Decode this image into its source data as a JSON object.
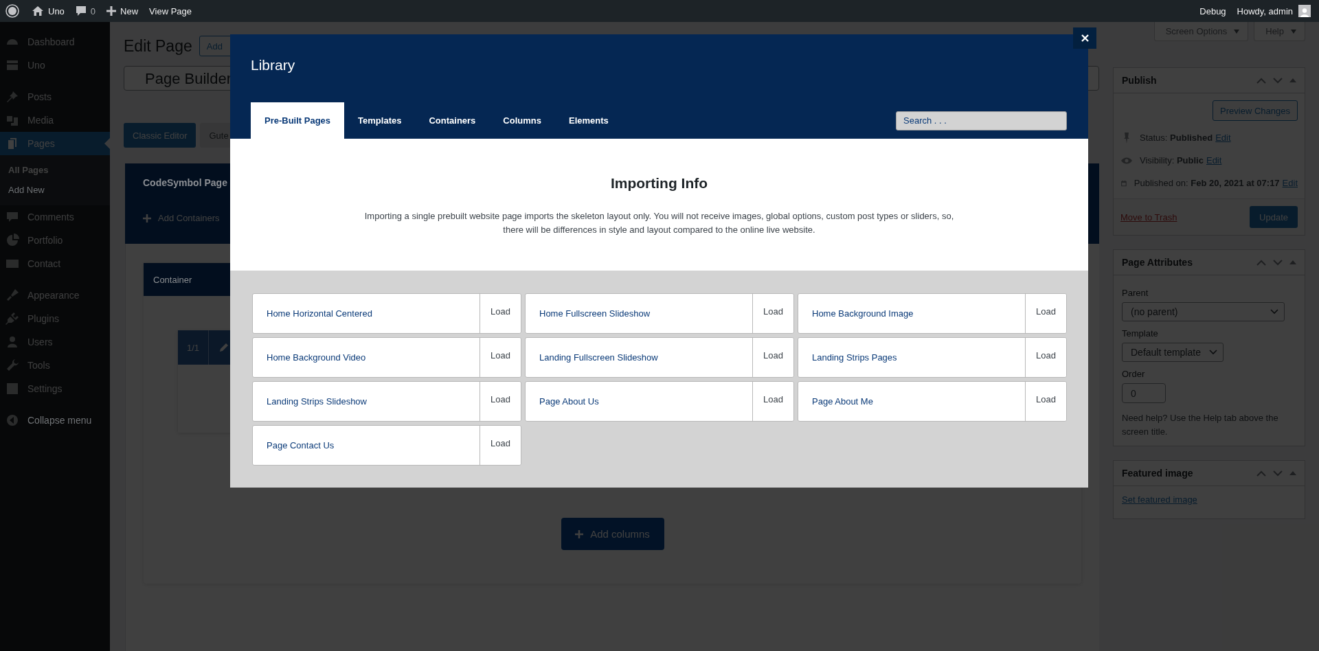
{
  "admin_bar": {
    "site": "Uno",
    "comments": "0",
    "new": "New",
    "view": "View Page",
    "debug": "Debug",
    "howdy": "Howdy, admin"
  },
  "sidebar": {
    "groups": [
      [
        {
          "label": "Dashboard",
          "selected": false
        },
        {
          "label": "Uno",
          "selected": false
        }
      ],
      [
        {
          "label": "Posts",
          "selected": false
        },
        {
          "label": "Media",
          "selected": false
        },
        {
          "label": "Pages",
          "selected": true,
          "children": [
            {
              "label": "All Pages",
              "selected": true
            },
            {
              "label": "Add New",
              "selected": false
            }
          ]
        },
        {
          "label": "Comments",
          "selected": false
        },
        {
          "label": "Portfolio",
          "selected": false
        },
        {
          "label": "Contact",
          "selected": false
        }
      ],
      [
        {
          "label": "Appearance",
          "selected": false
        },
        {
          "label": "Plugins",
          "selected": false
        },
        {
          "label": "Users",
          "selected": false
        },
        {
          "label": "Tools",
          "selected": false
        },
        {
          "label": "Settings",
          "selected": false
        }
      ]
    ],
    "collapse": "Collapse menu"
  },
  "screen_meta": [
    "Screen Options",
    "Help"
  ],
  "editor": {
    "title": "Edit Page",
    "add_new": "Add",
    "page_title": "Page Builder",
    "editor_buttons": [
      {
        "label": "Classic Editor",
        "selected": true
      },
      {
        "label": "Gute",
        "selected": false
      }
    ],
    "builder": {
      "title": "CodeSymbol Page",
      "add_containers": "Add Containers",
      "container": "Container",
      "column_ratio": "1/1",
      "add_columns": "Add columns"
    }
  },
  "publish": {
    "title": "Publish",
    "preview": "Preview Changes",
    "rows": [
      {
        "text": "Status: **Published**",
        "link": "Edit"
      },
      {
        "text": "Visibility: **Public**",
        "link": "Edit"
      },
      {
        "text": "Published on: **Feb 20, 2021 at 07:17**",
        "link": "Edit"
      }
    ],
    "trash": "Move to Trash",
    "update": "Update"
  },
  "page_attributes": {
    "title": "Page Attributes",
    "parent_label": "Parent",
    "parent": "(no parent)",
    "template_label": "Template",
    "template": "Default template",
    "order_label": "Order",
    "order": "0",
    "help": "Need help? Use the Help tab above the screen title."
  },
  "featured_image": {
    "title": "Featured image",
    "link": "Set featured image"
  },
  "modal": {
    "title": "Library",
    "tabs": [
      {
        "label": "Pre-Built Pages",
        "selected": true
      },
      {
        "label": "Templates",
        "selected": false
      },
      {
        "label": "Containers",
        "selected": false
      },
      {
        "label": "Columns",
        "selected": false
      },
      {
        "label": "Elements",
        "selected": false
      }
    ],
    "search": {
      "placeholder": "Search . . ."
    },
    "info": {
      "heading": "Importing Info",
      "text": "Importing a single prebuilt website page imports the skeleton layout only. You will not receive images, global options, custom post types or sliders, so, there will be differences in style and layout compared to the online live website."
    },
    "pages": [
      {
        "name": "Home Horizontal Centered",
        "action": "Load"
      },
      {
        "name": "Home Fullscreen Slideshow",
        "action": "Load"
      },
      {
        "name": "Home Background Image",
        "action": "Load"
      },
      {
        "name": "Home Background Video",
        "action": "Load"
      },
      {
        "name": "Landing Fullscreen Slideshow",
        "action": "Load"
      },
      {
        "name": "Landing Strips Pages",
        "action": "Load"
      },
      {
        "name": "Landing Strips Slideshow",
        "action": "Load"
      },
      {
        "name": "Page About Us",
        "action": "Load"
      },
      {
        "name": "Page About Me",
        "action": "Load"
      },
      {
        "name": "Page Contact Us",
        "action": "Load"
      }
    ]
  }
}
